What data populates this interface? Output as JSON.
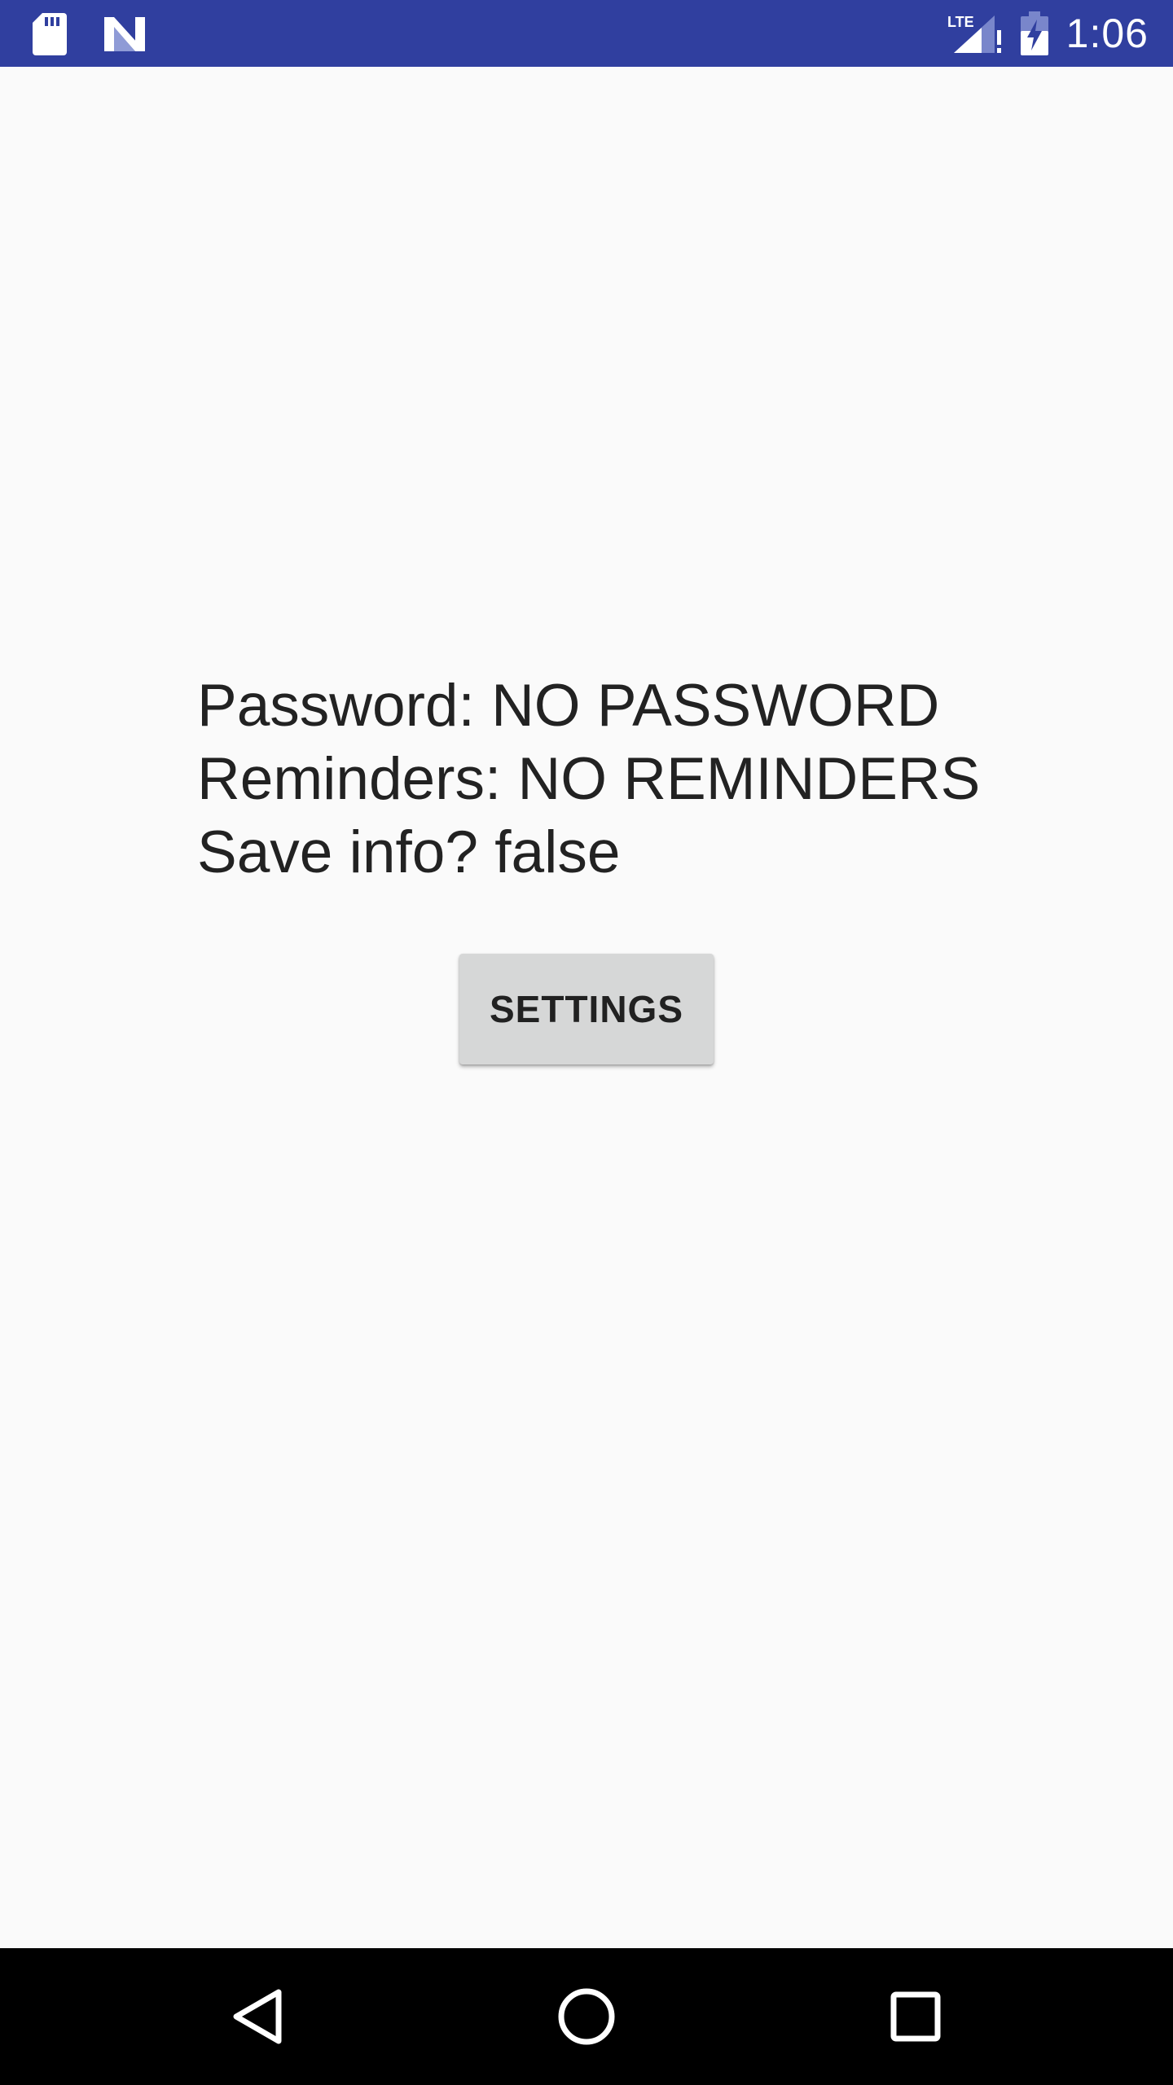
{
  "status_bar": {
    "time": "1:06",
    "network_label": "LTE",
    "icons": [
      "sd-card-icon",
      "n-logo-icon",
      "lte-signal-icon",
      "battery-charging-icon"
    ],
    "background_color": "#303f9f"
  },
  "main": {
    "password_line": "Password: NO PASSWORD",
    "reminders_line": "Reminders: NO REMINDERS",
    "save_info_line": "Save info? false",
    "settings_button_label": "SETTINGS"
  },
  "nav_bar": {
    "buttons": [
      "back-icon",
      "home-icon",
      "recents-icon"
    ]
  }
}
